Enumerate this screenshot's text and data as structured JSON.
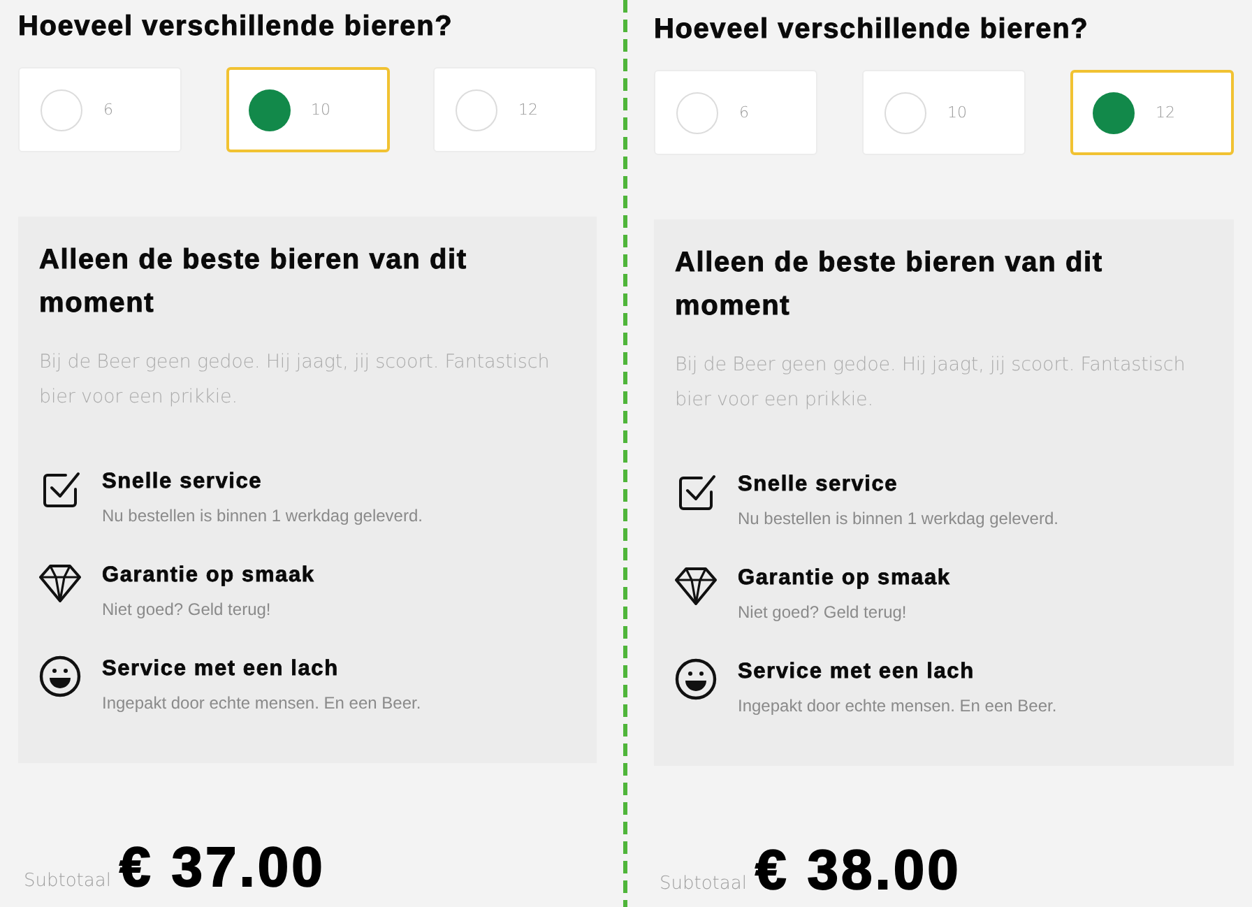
{
  "panels": [
    {
      "question": "Hoeveel verschillende bieren?",
      "options": [
        {
          "label": "6",
          "selected": false
        },
        {
          "label": "10",
          "selected": true
        },
        {
          "label": "12",
          "selected": false
        }
      ],
      "info": {
        "title": "Alleen de beste bieren van dit moment",
        "text": "Bij de Beer geen gedoe. Hij jaagt, jij scoort. Fantastisch bier voor een prikkie.",
        "features": [
          {
            "title": "Snelle service",
            "text": "Nu bestellen is binnen 1 werkdag geleverd."
          },
          {
            "title": "Garantie op smaak",
            "text": "Niet goed? Geld terug!"
          },
          {
            "title": "Service met een lach",
            "text": "Ingepakt door echte mensen. En een Beer."
          }
        ]
      },
      "subtotal": {
        "label": "Subtotaal",
        "amount": "€ 37.00"
      }
    },
    {
      "question": "Hoeveel verschillende bieren?",
      "options": [
        {
          "label": "6",
          "selected": false
        },
        {
          "label": "10",
          "selected": false
        },
        {
          "label": "12",
          "selected": true
        }
      ],
      "info": {
        "title": "Alleen de beste bieren van dit moment",
        "text": "Bij de Beer geen gedoe. Hij jaagt, jij scoort. Fantastisch bier voor een prikkie.",
        "features": [
          {
            "title": "Snelle service",
            "text": "Nu bestellen is binnen 1 werkdag geleverd."
          },
          {
            "title": "Garantie op smaak",
            "text": "Niet goed? Geld terug!"
          },
          {
            "title": "Service met een lach",
            "text": "Ingepakt door echte mensen. En een Beer."
          }
        ]
      },
      "subtotal": {
        "label": "Subtotaal",
        "amount": "€ 38.00"
      }
    }
  ]
}
